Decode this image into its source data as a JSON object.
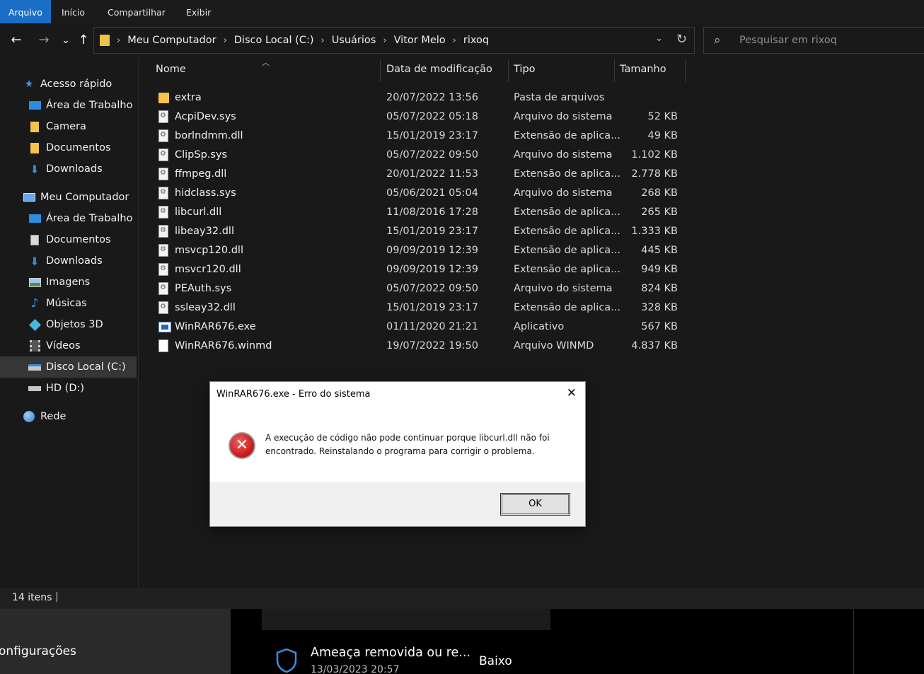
{
  "ribbon": {
    "tabs": [
      "Arquivo",
      "Início",
      "Compartilhar",
      "Exibir"
    ]
  },
  "nav": {
    "back": "←",
    "forward": "→",
    "recent": "⌄",
    "up": "↑"
  },
  "address": {
    "crumbs": [
      "Meu Computador",
      "Disco Local (C:)",
      "Usuários",
      "Vitor Melo",
      "rixoq"
    ]
  },
  "search": {
    "placeholder": "Pesquisar em rixoq"
  },
  "sidebar": {
    "items": [
      {
        "label": "Acesso rápido",
        "icon": "star-icon"
      },
      {
        "label": "Área de Trabalho",
        "icon": "desktop-icon"
      },
      {
        "label": "Camera",
        "icon": "folder-icon"
      },
      {
        "label": "Documentos",
        "icon": "folder-icon"
      },
      {
        "label": "Downloads",
        "icon": "download-icon"
      },
      {
        "label": "Meu Computador",
        "icon": "computer-icon"
      },
      {
        "label": "Área de Trabalho",
        "icon": "desktop-icon"
      },
      {
        "label": "Documentos",
        "icon": "documents-icon"
      },
      {
        "label": "Downloads",
        "icon": "download-icon"
      },
      {
        "label": "Imagens",
        "icon": "pictures-icon"
      },
      {
        "label": "Músicas",
        "icon": "music-icon"
      },
      {
        "label": "Objetos 3D",
        "icon": "3d-objects-icon"
      },
      {
        "label": "Vídeos",
        "icon": "videos-icon"
      },
      {
        "label": "Disco Local (C:)",
        "icon": "drive-icon"
      },
      {
        "label": "HD  (D:)",
        "icon": "drive-icon"
      },
      {
        "label": "Rede",
        "icon": "network-icon"
      }
    ]
  },
  "columns": {
    "name": "Nome",
    "date": "Data de modificação",
    "type": "Tipo",
    "size": "Tamanho"
  },
  "files": [
    {
      "name": "extra",
      "date": "20/07/2022 13:56",
      "type": "Pasta de arquivos",
      "size": "",
      "icon": "folder"
    },
    {
      "name": "AcpiDev.sys",
      "date": "05/07/2022 05:18",
      "type": "Arquivo do sistema",
      "size": "52 KB",
      "icon": "sys"
    },
    {
      "name": "borlndmm.dll",
      "date": "15/01/2019 23:17",
      "type": "Extensão de aplica...",
      "size": "49 KB",
      "icon": "sys"
    },
    {
      "name": "ClipSp.sys",
      "date": "05/07/2022 09:50",
      "type": "Arquivo do sistema",
      "size": "1.102 KB",
      "icon": "sys"
    },
    {
      "name": "ffmpeg.dll",
      "date": "20/01/2022 11:53",
      "type": "Extensão de aplica...",
      "size": "2.778 KB",
      "icon": "sys"
    },
    {
      "name": "hidclass.sys",
      "date": "05/06/2021 05:04",
      "type": "Arquivo do sistema",
      "size": "268 KB",
      "icon": "sys"
    },
    {
      "name": "libcurl.dll",
      "date": "11/08/2016 17:28",
      "type": "Extensão de aplica...",
      "size": "265 KB",
      "icon": "sys"
    },
    {
      "name": "libeay32.dll",
      "date": "15/01/2019 23:17",
      "type": "Extensão de aplica...",
      "size": "1.333 KB",
      "icon": "sys"
    },
    {
      "name": "msvcp120.dll",
      "date": "09/09/2019 12:39",
      "type": "Extensão de aplica...",
      "size": "445 KB",
      "icon": "sys"
    },
    {
      "name": "msvcr120.dll",
      "date": "09/09/2019 12:39",
      "type": "Extensão de aplica...",
      "size": "949 KB",
      "icon": "sys"
    },
    {
      "name": "PEAuth.sys",
      "date": "05/07/2022 09:50",
      "type": "Arquivo do sistema",
      "size": "824 KB",
      "icon": "sys"
    },
    {
      "name": "ssleay32.dll",
      "date": "15/01/2019 23:17",
      "type": "Extensão de aplica...",
      "size": "328 KB",
      "icon": "sys"
    },
    {
      "name": "WinRAR676.exe",
      "date": "01/11/2020 21:21",
      "type": "Aplicativo",
      "size": "567 KB",
      "icon": "exe"
    },
    {
      "name": "WinRAR676.winmd",
      "date": "19/07/2022 19:50",
      "type": "Arquivo WINMD",
      "size": "4.837 KB",
      "icon": "doc"
    }
  ],
  "status": {
    "count": "14 itens"
  },
  "dialog": {
    "title": "WinRAR676.exe - Erro do sistema",
    "message": "A execução de código não pode continuar porque libcurl.dll não foi encontrado. Reinstalando o programa para corrigir o problema.",
    "ok_label": "OK",
    "close_glyph": "✕"
  },
  "background_window": {
    "settings_label": "onfigurações",
    "threat_title": "Ameaça removida ou re...",
    "threat_date": "13/03/2023 20:57",
    "threat_level": "Baixo"
  }
}
